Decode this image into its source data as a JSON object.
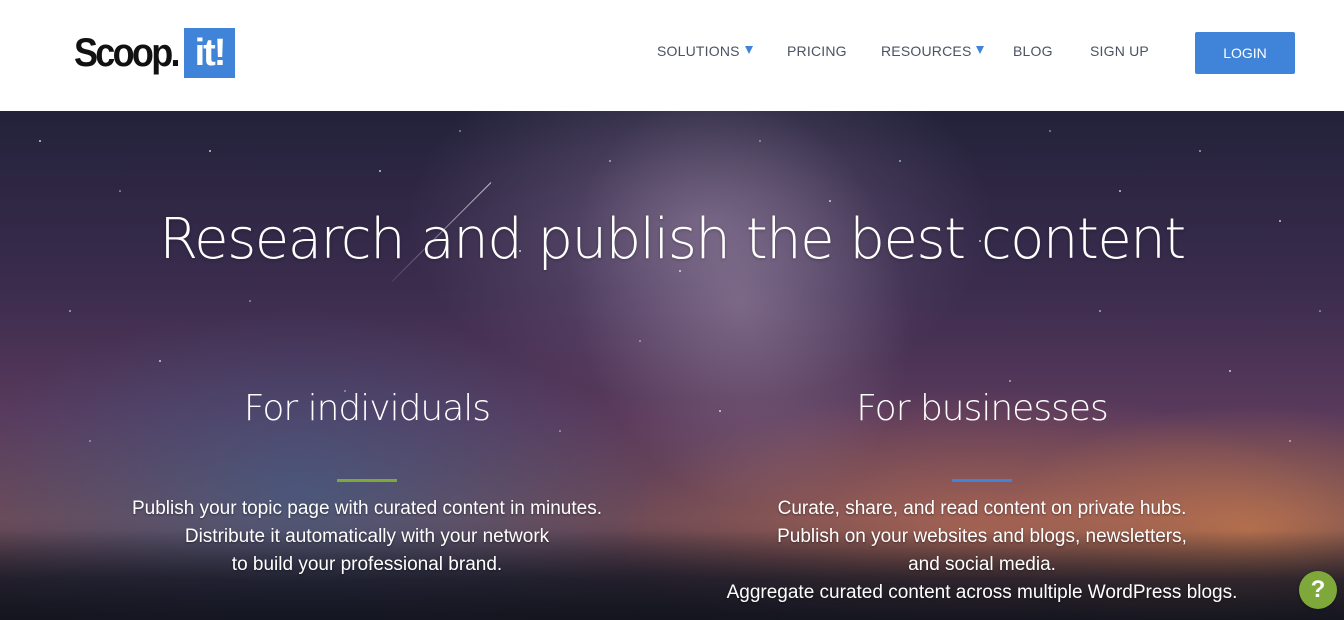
{
  "logo": {
    "word": "Scoop.",
    "box": "it!"
  },
  "nav": {
    "items": [
      {
        "label": "SOLUTIONS",
        "dropdown": true
      },
      {
        "label": "PRICING",
        "dropdown": false
      },
      {
        "label": "RESOURCES",
        "dropdown": true
      },
      {
        "label": "BLOG",
        "dropdown": false
      },
      {
        "label": "SIGN UP",
        "dropdown": false
      }
    ],
    "login_label": "LOGIN"
  },
  "hero": {
    "title": "Research and publish the best content",
    "individuals": {
      "heading": "For individuals",
      "lines": [
        "Publish your topic page with curated content in minutes.",
        "Distribute it automatically with your network",
        "to build your professional brand."
      ],
      "accent": "#7fa83a"
    },
    "businesses": {
      "heading": "For businesses",
      "lines": [
        "Curate, share, and read content on private hubs.",
        "Publish on your websites and blogs, newsletters,",
        "and social media.",
        "Aggregate curated content across multiple WordPress blogs."
      ],
      "accent": "#3f84d8"
    }
  },
  "help_button": {
    "label": "?",
    "icon": "help-question-icon",
    "color": "#7fa83a"
  },
  "colors": {
    "brand_blue": "#3f84d8",
    "nav_text": "#4a5363"
  }
}
